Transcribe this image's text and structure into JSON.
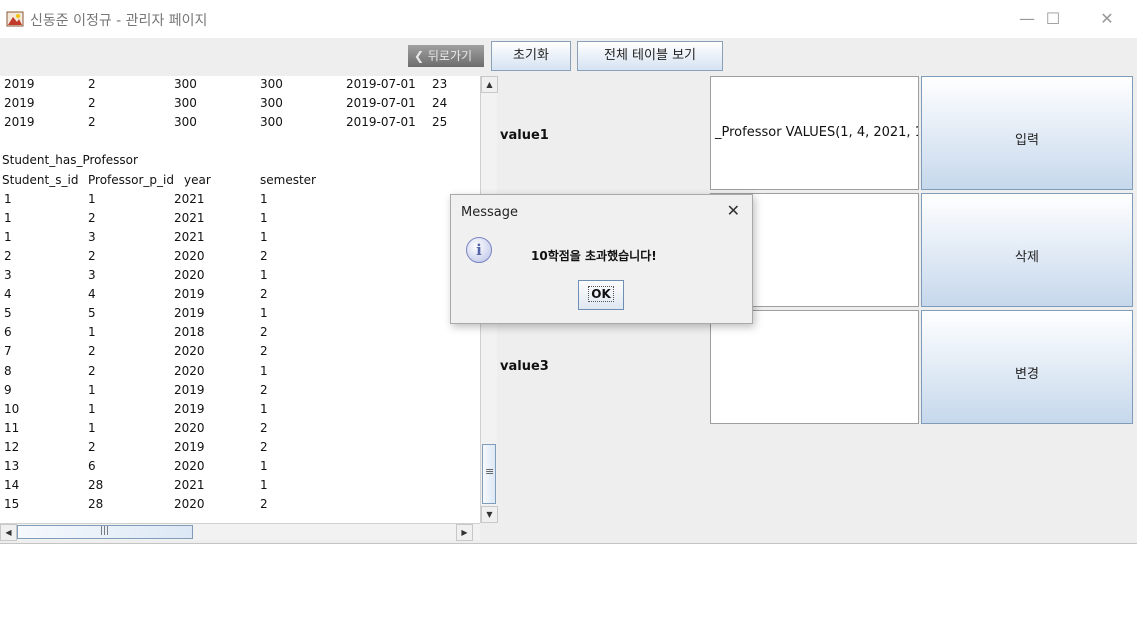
{
  "window": {
    "title": "신동준 이정규 - 관리자 페이지",
    "controls": {
      "minimize": "—",
      "maximize": "☐",
      "close": "✕"
    }
  },
  "toolbar": {
    "back_label": "❮ 뒤로가기",
    "reset_label": "초기화",
    "view_all_label": "전체 테이블 보기"
  },
  "table_text": {
    "top_rows": [
      [
        "2019",
        "2",
        "300",
        "300",
        "2019-07-01",
        "23"
      ],
      [
        "2019",
        "2",
        "300",
        "300",
        "2019-07-01",
        "24"
      ],
      [
        "2019",
        "2",
        "300",
        "300",
        "2019-07-01",
        "25"
      ]
    ],
    "section_title": "Student_has_Professor",
    "headers": [
      "Student_s_id",
      "Professor_p_id",
      "year",
      "semester"
    ],
    "rows": [
      [
        "1",
        "1",
        "2021",
        "1"
      ],
      [
        "1",
        "2",
        "2021",
        "1"
      ],
      [
        "1",
        "3",
        "2021",
        "1"
      ],
      [
        "2",
        "2",
        "2020",
        "2"
      ],
      [
        "3",
        "3",
        "2020",
        "1"
      ],
      [
        "4",
        "4",
        "2019",
        "2"
      ],
      [
        "5",
        "5",
        "2019",
        "1"
      ],
      [
        "6",
        "1",
        "2018",
        "2"
      ],
      [
        "7",
        "2",
        "2020",
        "2"
      ],
      [
        "8",
        "2",
        "2020",
        "1"
      ],
      [
        "9",
        "1",
        "2019",
        "2"
      ],
      [
        "10",
        "1",
        "2019",
        "1"
      ],
      [
        "11",
        "1",
        "2020",
        "2"
      ],
      [
        "12",
        "2",
        "2019",
        "2"
      ],
      [
        "13",
        "6",
        "2020",
        "1"
      ],
      [
        "14",
        "28",
        "2021",
        "1"
      ],
      [
        "15",
        "28",
        "2020",
        "2"
      ]
    ]
  },
  "form": {
    "value1_label": "value1",
    "value1_text": "_Professor VALUES(1, 4, 2021, 1",
    "value2_text": "",
    "value3_label": "value3",
    "value3_text": "",
    "insert_label": "입력",
    "delete_label": "삭제",
    "update_label": "변경"
  },
  "dialog": {
    "title": "Message",
    "close": "✕",
    "icon_glyph": "i",
    "message": "10학점을 초과했습니다!",
    "ok_label": "OK"
  },
  "scroll": {
    "up": "▲",
    "down": "▼",
    "left": "◀",
    "right": "▶",
    "grip_v": "≡",
    "grip_h": "|||"
  }
}
